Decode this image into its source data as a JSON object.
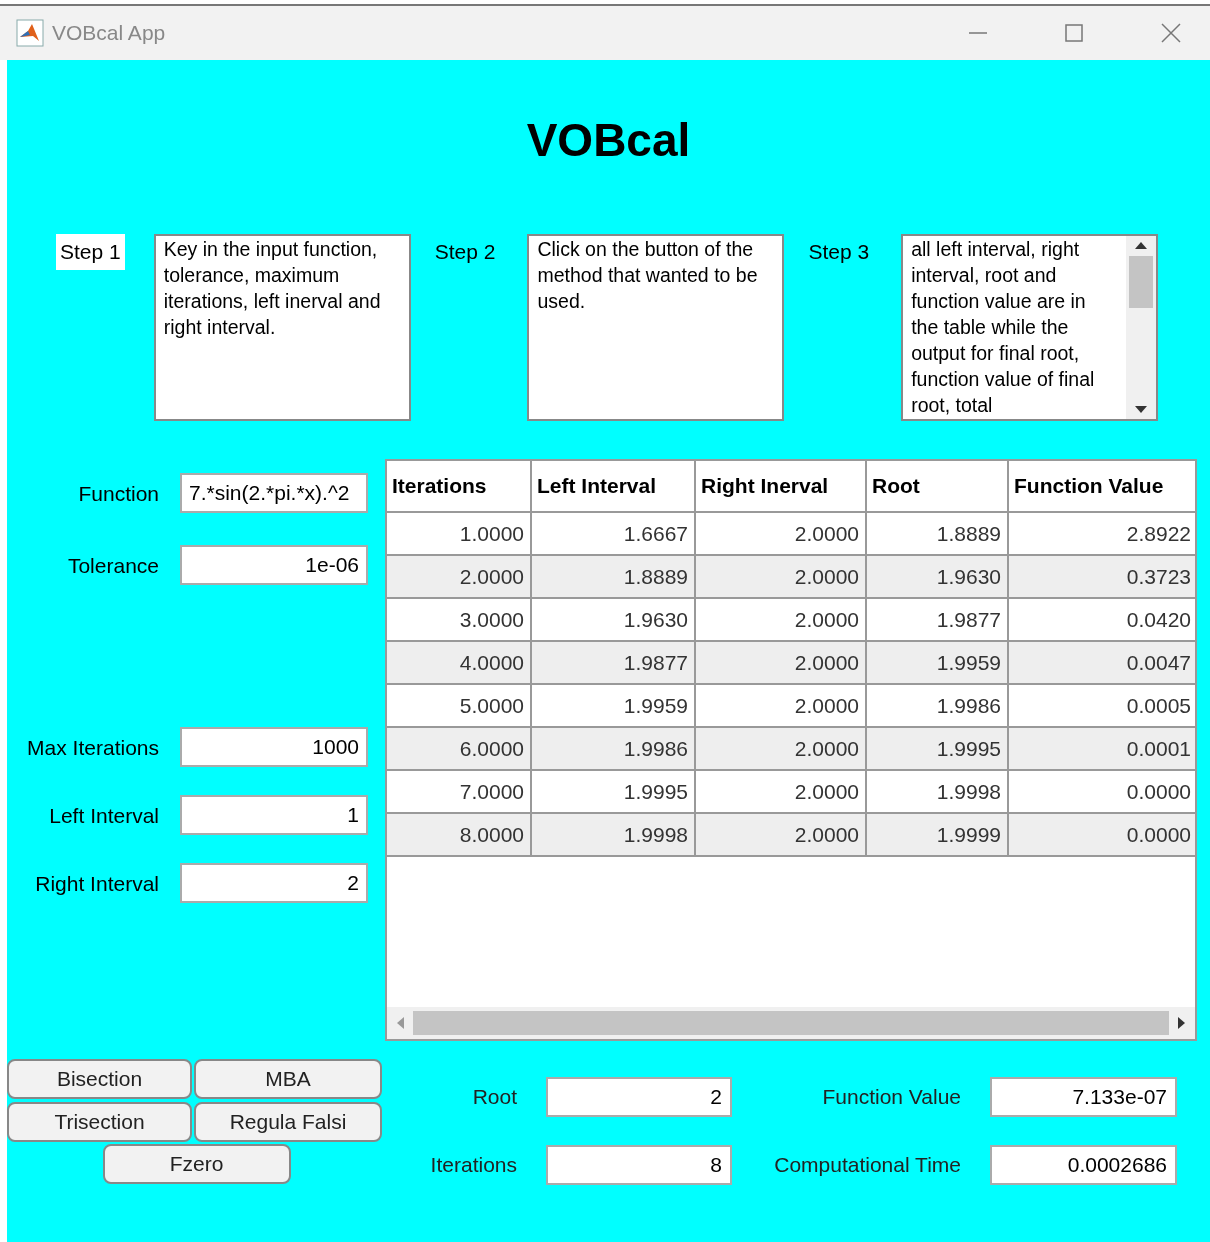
{
  "window": {
    "title": "VOBcal App"
  },
  "heading": "VOBcal",
  "steps": [
    {
      "label": "Step 1",
      "text": "Key in the input function, tolerance, maximum iterations, left inerval and right interval.",
      "scrollable": false
    },
    {
      "label": "Step 2",
      "text": "Click on the button of the method that wanted to be used.",
      "scrollable": false
    },
    {
      "label": "Step 3",
      "text": "all left interval, right interval, root and function value are in the table while the output for final root, function value of final root, total",
      "scrollable": true
    }
  ],
  "inputs": [
    {
      "label": "Function",
      "value": "7.*sin(2.*pi.*x).^2",
      "kind": "text"
    },
    {
      "label": "Tolerance",
      "value": "1e-06",
      "kind": "numeric"
    },
    {
      "label": "Max Iterations",
      "value": "1000",
      "kind": "numeric"
    },
    {
      "label": "Left Interval",
      "value": "1",
      "kind": "numeric"
    },
    {
      "label": "Right Interval",
      "value": "2",
      "kind": "numeric"
    }
  ],
  "table": {
    "columns": [
      "Iterations",
      "Left Interval",
      "Right Inerval",
      "Root",
      "Function Value"
    ],
    "rows": [
      [
        "1.0000",
        "1.6667",
        "2.0000",
        "1.8889",
        "2.8922"
      ],
      [
        "2.0000",
        "1.8889",
        "2.0000",
        "1.9630",
        "0.3723"
      ],
      [
        "3.0000",
        "1.9630",
        "2.0000",
        "1.9877",
        "0.0420"
      ],
      [
        "4.0000",
        "1.9877",
        "2.0000",
        "1.9959",
        "0.0047"
      ],
      [
        "5.0000",
        "1.9959",
        "2.0000",
        "1.9986",
        "0.0005"
      ],
      [
        "6.0000",
        "1.9986",
        "2.0000",
        "1.9995",
        "0.0001"
      ],
      [
        "7.0000",
        "1.9995",
        "2.0000",
        "1.9998",
        "0.0000"
      ],
      [
        "8.0000",
        "1.9998",
        "2.0000",
        "1.9999",
        "0.0000"
      ]
    ]
  },
  "methods": [
    "Bisection",
    "MBA",
    "Trisection",
    "Regula Falsi",
    "Fzero"
  ],
  "outputs": [
    {
      "label": "Root",
      "value": "2"
    },
    {
      "label": "Function Value",
      "value": "7.133e-07"
    },
    {
      "label": "Iterations",
      "value": "8"
    },
    {
      "label": "Computational Time",
      "value": "0.0002686"
    }
  ]
}
